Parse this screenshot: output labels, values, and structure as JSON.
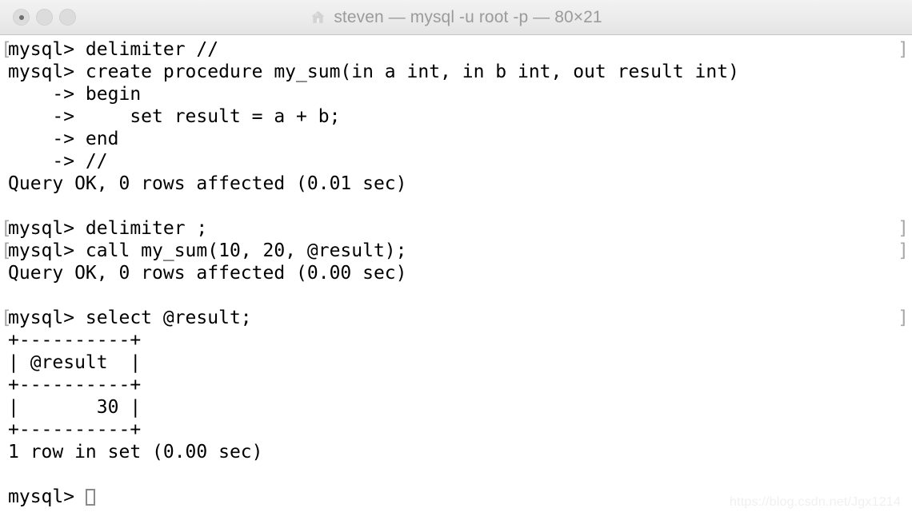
{
  "window": {
    "title": "steven — mysql -u root -p — 80×21",
    "home_icon": "home-icon",
    "traffic_lights": [
      {
        "name": "close-button",
        "label": "Close"
      },
      {
        "name": "minimize-button",
        "label": "Minimize"
      },
      {
        "name": "zoom-button",
        "label": "Zoom"
      }
    ]
  },
  "terminal": {
    "cols": 80,
    "rows": 21,
    "background_color": "#ffffff",
    "foreground_color": "#000000",
    "marker_color": "#a8a8a8",
    "cursor": {
      "style": "hollow-block",
      "color": "#8a8a8a"
    },
    "lines": [
      {
        "text": "mysql> delimiter //",
        "marked": true
      },
      {
        "text": "mysql> create procedure my_sum(in a int, in b int, out result int)",
        "marked": false
      },
      {
        "text": "    -> begin",
        "marked": false
      },
      {
        "text": "    ->     set result = a + b;",
        "marked": false
      },
      {
        "text": "    -> end",
        "marked": false
      },
      {
        "text": "    -> //",
        "marked": false
      },
      {
        "text": "Query OK, 0 rows affected (0.01 sec)",
        "marked": false
      },
      {
        "text": "",
        "marked": false
      },
      {
        "text": "mysql> delimiter ;",
        "marked": true
      },
      {
        "text": "mysql> call my_sum(10, 20, @result);",
        "marked": true
      },
      {
        "text": "Query OK, 0 rows affected (0.00 sec)",
        "marked": false
      },
      {
        "text": "",
        "marked": false
      },
      {
        "text": "mysql> select @result;",
        "marked": true
      },
      {
        "text": "+----------+",
        "marked": false
      },
      {
        "text": "| @result  |",
        "marked": false
      },
      {
        "text": "+----------+",
        "marked": false
      },
      {
        "text": "|       30 |",
        "marked": false
      },
      {
        "text": "+----------+",
        "marked": false
      },
      {
        "text": "1 row in set (0.00 sec)",
        "marked": false
      },
      {
        "text": "",
        "marked": false
      },
      {
        "text": "mysql> ",
        "marked": false,
        "cursor": true
      }
    ],
    "result_table": {
      "headers": [
        "@result"
      ],
      "rows": [
        [
          "30"
        ]
      ],
      "row_count_text": "1 row in set (0.00 sec)"
    },
    "prompt": "mysql>"
  },
  "watermark": {
    "text": "https://blog.csdn.net/Jgx1214"
  }
}
